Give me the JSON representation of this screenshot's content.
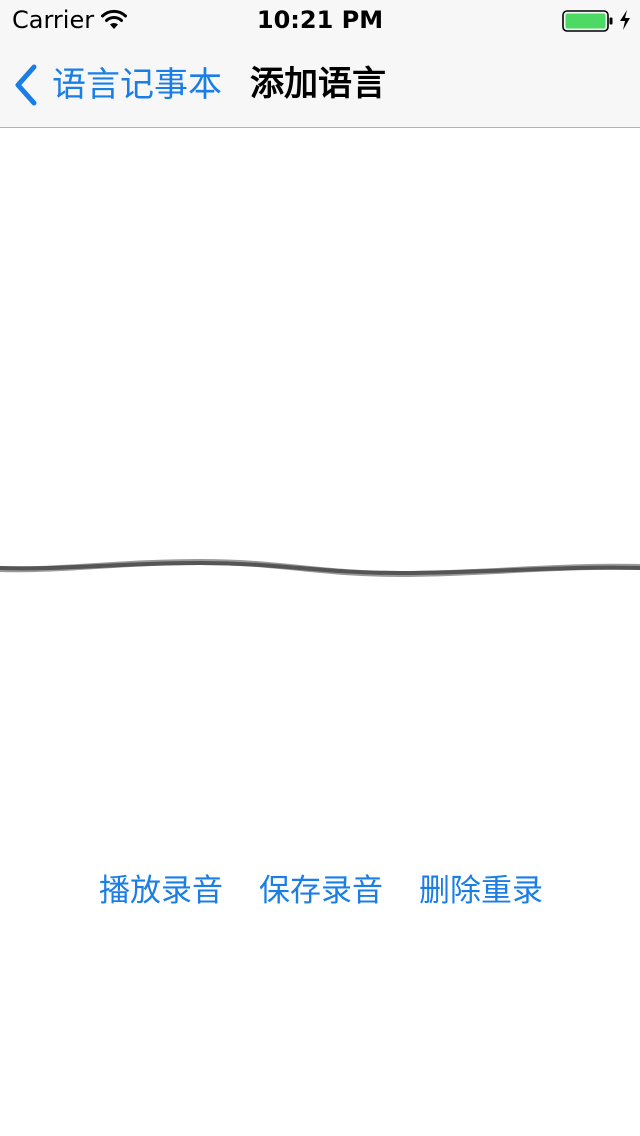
{
  "status_bar": {
    "carrier": "Carrier",
    "time": "10:21 PM",
    "wifi_icon": "wifi-icon",
    "battery_icon": "battery-icon",
    "battery_color": "#4cd964",
    "charging_icon": "bolt-icon"
  },
  "nav": {
    "back_label": "语言记事本",
    "back_icon": "chevron-left-icon",
    "title": "添加语言",
    "tint_color": "#1a7ee6"
  },
  "waveform": {
    "color": "#555555"
  },
  "actions": {
    "play_label": "播放录音",
    "save_label": "保存录音",
    "delete_label": "删除重录"
  }
}
